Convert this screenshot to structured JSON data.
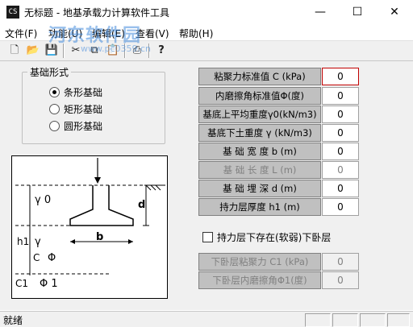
{
  "window": {
    "title": "无标题 - 地基承载力计算软件工具",
    "icon_text": "CS",
    "minimize_glyph": "—",
    "maximize_glyph": "☐",
    "close_glyph": "✕"
  },
  "watermark": {
    "text": "河东软件园",
    "url": "www.pc0359.cn"
  },
  "menu": [
    "文件(F)",
    "功能(U)",
    "编辑(E)",
    "查看(V)",
    "帮助(H)"
  ],
  "toolbar": {
    "new": "🗋",
    "open": "📂",
    "save": "💾",
    "cut": "✂",
    "copy": "⧉",
    "paste": "📋",
    "print": "⎙",
    "help": "?"
  },
  "foundation_type": {
    "title": "基础形式",
    "options": [
      "条形基础",
      "矩形基础",
      "圆形基础"
    ],
    "selected": 0
  },
  "diagram": {
    "gamma0": "γ 0",
    "d": "d",
    "h1": "h1",
    "gamma": "γ",
    "c": "C",
    "phi": "Φ",
    "b": "b",
    "c1": "C1",
    "phi1": "Φ 1"
  },
  "parameters": [
    {
      "label": "粘聚力标准值 C (kPa)",
      "value": "0",
      "focused": true,
      "disabled": false
    },
    {
      "label": "内磨擦角标准值Φ(度)",
      "value": "0",
      "focused": false,
      "disabled": false
    },
    {
      "label": "基底上平均重度γ0(kN/m3)",
      "value": "0",
      "focused": false,
      "disabled": false
    },
    {
      "label": "基底下土重度 γ (kN/m3)",
      "value": "0",
      "focused": false,
      "disabled": false
    },
    {
      "label": "基 础 宽 度 b  (m)",
      "value": "0",
      "focused": false,
      "disabled": false
    },
    {
      "label": "基 础 长 度 L  (m)",
      "value": "0",
      "focused": false,
      "disabled": true
    },
    {
      "label": "基 础 埋 深 d  (m)",
      "value": "0",
      "focused": false,
      "disabled": false
    },
    {
      "label": "持力层厚度 h1  (m)",
      "value": "0",
      "focused": false,
      "disabled": false
    }
  ],
  "soft_layer": {
    "checkbox_label": "持力层下存在(软弱)下卧层",
    "checked": false,
    "params": [
      {
        "label": "下卧层粘聚力 C1 (kPa)",
        "value": "0"
      },
      {
        "label": "下卧层内磨擦角Φ1(度)",
        "value": "0"
      }
    ]
  },
  "status": {
    "text": "就绪"
  }
}
